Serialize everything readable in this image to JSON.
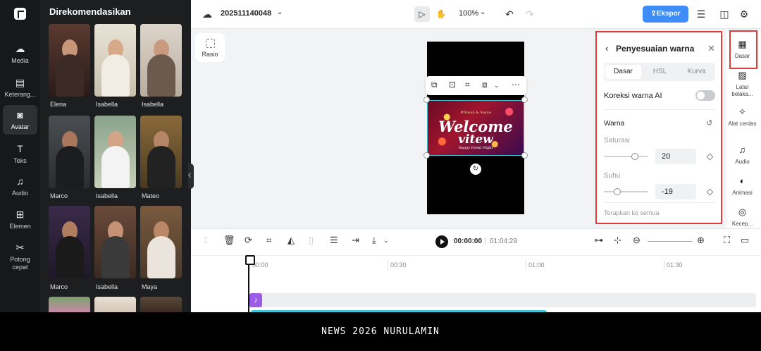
{
  "rail": {
    "items": [
      {
        "label": "Media",
        "icon": "cloud-upload-icon"
      },
      {
        "label": "Keterang...",
        "icon": "subtitles-icon"
      },
      {
        "label": "Avatar",
        "icon": "avatar-icon"
      },
      {
        "label": "Teks",
        "icon": "text-icon"
      },
      {
        "label": "Audio",
        "icon": "music-note-icon"
      },
      {
        "label": "Elemen",
        "icon": "elements-icon"
      },
      {
        "label": "Potong cepat",
        "icon": "scissors-icon"
      }
    ],
    "active": "Avatar"
  },
  "avatar_panel": {
    "title": "Direkomendasikan",
    "avatars": [
      {
        "name": "Elena"
      },
      {
        "name": "Isabella"
      },
      {
        "name": "Isabella"
      },
      {
        "name": "Marco"
      },
      {
        "name": "Isabella"
      },
      {
        "name": "Mateo"
      },
      {
        "name": "Marco"
      },
      {
        "name": "Isabella"
      },
      {
        "name": "Maya"
      }
    ]
  },
  "topbar": {
    "project_name": "202511140048",
    "zoom": "100%",
    "export_label": "Ekspor"
  },
  "canvas": {
    "ratio_label": "Rasio",
    "clip_text_main": "Welcome",
    "clip_text_sub": "vitew",
    "clip_text_top": "#Diwali & Vogue",
    "clip_text_bottom": "Happy Event Night"
  },
  "color_panel": {
    "title": "Penyesuaian warna",
    "tabs": [
      "Dasar",
      "HSL",
      "Kurva"
    ],
    "selected_tab": "Dasar",
    "ai_label": "Koreksi warna AI",
    "ai_enabled": false,
    "section": "Warna",
    "saturation_label": "Saturasi",
    "saturation_value": "20",
    "temperature_label": "Suhu",
    "temperature_value": "-19",
    "apply_all": "Terapkan ke semua"
  },
  "right_sidebar": {
    "items": [
      {
        "label": "Dasar",
        "icon": "film-adjust-icon"
      },
      {
        "label": "Latar belaka...",
        "icon": "background-icon"
      },
      {
        "label": "Alat cerdas",
        "icon": "magic-wand-icon"
      },
      {
        "label": "Audio",
        "icon": "music-note-icon"
      },
      {
        "label": "Animasi",
        "icon": "animation-icon"
      },
      {
        "label": "Kecep...",
        "icon": "speed-gauge-icon"
      }
    ]
  },
  "timeline": {
    "current_time": "00:00:00",
    "total_time": "01:04:29",
    "ticks": [
      "00:00",
      "00:30",
      "01:00",
      "01:30"
    ]
  },
  "footer": {
    "text": "NEWS 2026 NURULAMIN"
  }
}
